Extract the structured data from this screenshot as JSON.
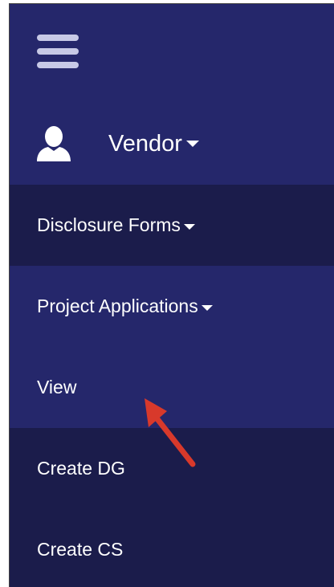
{
  "menu": {
    "hamburger_icon": "hamburger-menu-icon",
    "user": {
      "icon": "user-silhouette-icon",
      "label": "Vendor",
      "dropdown_icon": "caret-down-icon"
    },
    "items": [
      {
        "label": "Disclosure Forms",
        "has_dropdown": true,
        "background": "#1b1c4b"
      },
      {
        "label": "Project Applications",
        "has_dropdown": true,
        "background": "#25276b"
      },
      {
        "label": "View",
        "has_dropdown": false,
        "background": "#25276b"
      },
      {
        "label": "Create DG",
        "has_dropdown": false,
        "background": "#1b1c4b"
      },
      {
        "label": "Create CS",
        "has_dropdown": false,
        "background": "#1b1c4b"
      }
    ]
  },
  "annotation": {
    "type": "red arrow",
    "points_to": "View",
    "color": "#d8392b"
  },
  "colors": {
    "nav_blue": "#25276b",
    "nav_dark": "#1b1c4b",
    "text": "#ffffff",
    "hamburger": "#c7c9e6"
  }
}
